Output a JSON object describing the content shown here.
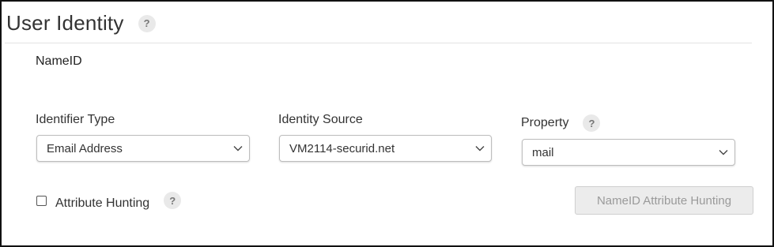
{
  "section": {
    "title": "User Identity",
    "help_glyph": "?"
  },
  "nameid": {
    "label": "NameID"
  },
  "fields": {
    "identifier_type": {
      "label": "Identifier Type",
      "value": "Email Address"
    },
    "identity_source": {
      "label": "Identity Source",
      "value": "VM2114-securid.net"
    },
    "property": {
      "label": "Property",
      "value": "mail",
      "help_glyph": "?"
    }
  },
  "attribute_hunting": {
    "label": "Attribute Hunting",
    "checked": false,
    "help_glyph": "?"
  },
  "nameid_button": {
    "label": "NameID Attribute Hunting",
    "disabled": true
  },
  "colors": {
    "border": "#111111",
    "help_bg": "#e9e9e9",
    "button_bg": "#ececec",
    "button_text": "#9a9a9a"
  },
  "icons": {
    "help": "help-icon",
    "chevron": "chevron-down-icon"
  }
}
